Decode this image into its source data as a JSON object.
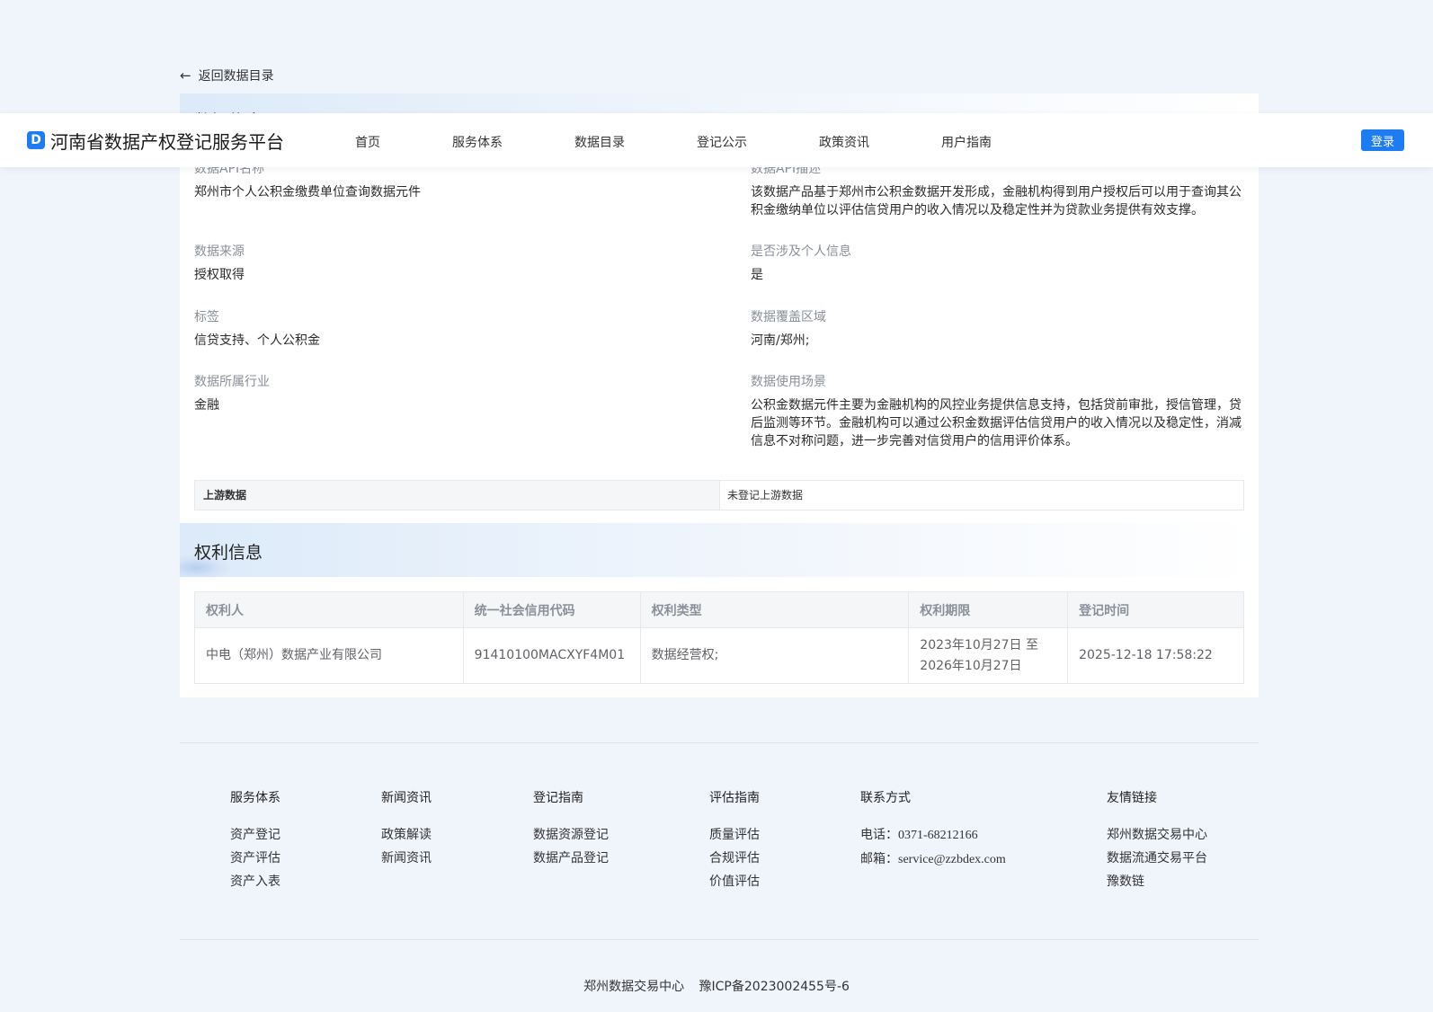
{
  "back": {
    "label": "返回数据目录"
  },
  "header": {
    "logo_glyph": "D",
    "title": "河南省数据产权登记服务平台",
    "nav": [
      "首页",
      "服务体系",
      "数据目录",
      "登记公示",
      "政策资讯",
      "用户指南"
    ],
    "login": "登录"
  },
  "data_info": {
    "title": "数据信息",
    "fields": {
      "api_name": {
        "label": "数据API名称",
        "value": "郑州市个人公积金缴费单位查询数据元件"
      },
      "api_desc": {
        "label": "数据API描述",
        "value": "该数据产品基于郑州市公积金数据开发形成，金融机构得到用户授权后可以用于查询其公积金缴纳单位以评估信贷用户的收入情况以及稳定性并为贷款业务提供有效支撑。"
      },
      "source": {
        "label": "数据来源",
        "value": "授权取得"
      },
      "personal": {
        "label": "是否涉及个人信息",
        "value": "是"
      },
      "tags": {
        "label": "标签",
        "value": "信贷支持、个人公积金"
      },
      "region": {
        "label": "数据覆盖区域",
        "value": "河南/郑州;"
      },
      "industry": {
        "label": "数据所属行业",
        "value": "金融"
      },
      "scenario": {
        "label": "数据使用场景",
        "value": "公积金数据元件主要为金融机构的风控业务提供信息支持，包括贷前审批，授信管理，贷后监测等环节。金融机构可以通过公积金数据评估信贷用户的收入情况以及稳定性，消减信息不对称问题，进一步完善对信贷用户的信用评价体系。"
      }
    },
    "upstream": {
      "label": "上游数据",
      "value": "未登记上游数据"
    }
  },
  "rights": {
    "title": "权利信息",
    "columns": [
      "权利人",
      "统一社会信用代码",
      "权利类型",
      "权利期限",
      "登记时间"
    ],
    "row": {
      "holder": "中电（郑州）数据产业有限公司",
      "credit_code": "91410100MACXYF4M01",
      "type": "数据经营权;",
      "period_start": "2023年10月27日 至",
      "period_end": "2026年10月27日",
      "registered": "2025-12-18 17:58:22"
    }
  },
  "footer": {
    "service": {
      "title": "服务体系",
      "items": [
        "资产登记",
        "资产评估",
        "资产入表"
      ]
    },
    "news": {
      "title": "新闻资讯",
      "items": [
        "政策解读",
        "新闻资讯"
      ]
    },
    "reg_guide": {
      "title": "登记指南",
      "items": [
        "数据资源登记",
        "数据产品登记"
      ]
    },
    "eval_guide": {
      "title": "评估指南",
      "items": [
        "质量评估",
        "合规评估",
        "价值评估"
      ]
    },
    "contact": {
      "title": "联系方式",
      "phone_label": "电话：",
      "phone": "0371-68212166",
      "email_label": "邮箱：",
      "email": "service@zzbdex.com"
    },
    "links": {
      "title": "友情链接",
      "items": [
        "郑州数据交易中心",
        "数据流通交易平台",
        "豫数链"
      ]
    },
    "org": "郑州数据交易中心",
    "icp": "豫ICP备2023002455号-6"
  }
}
